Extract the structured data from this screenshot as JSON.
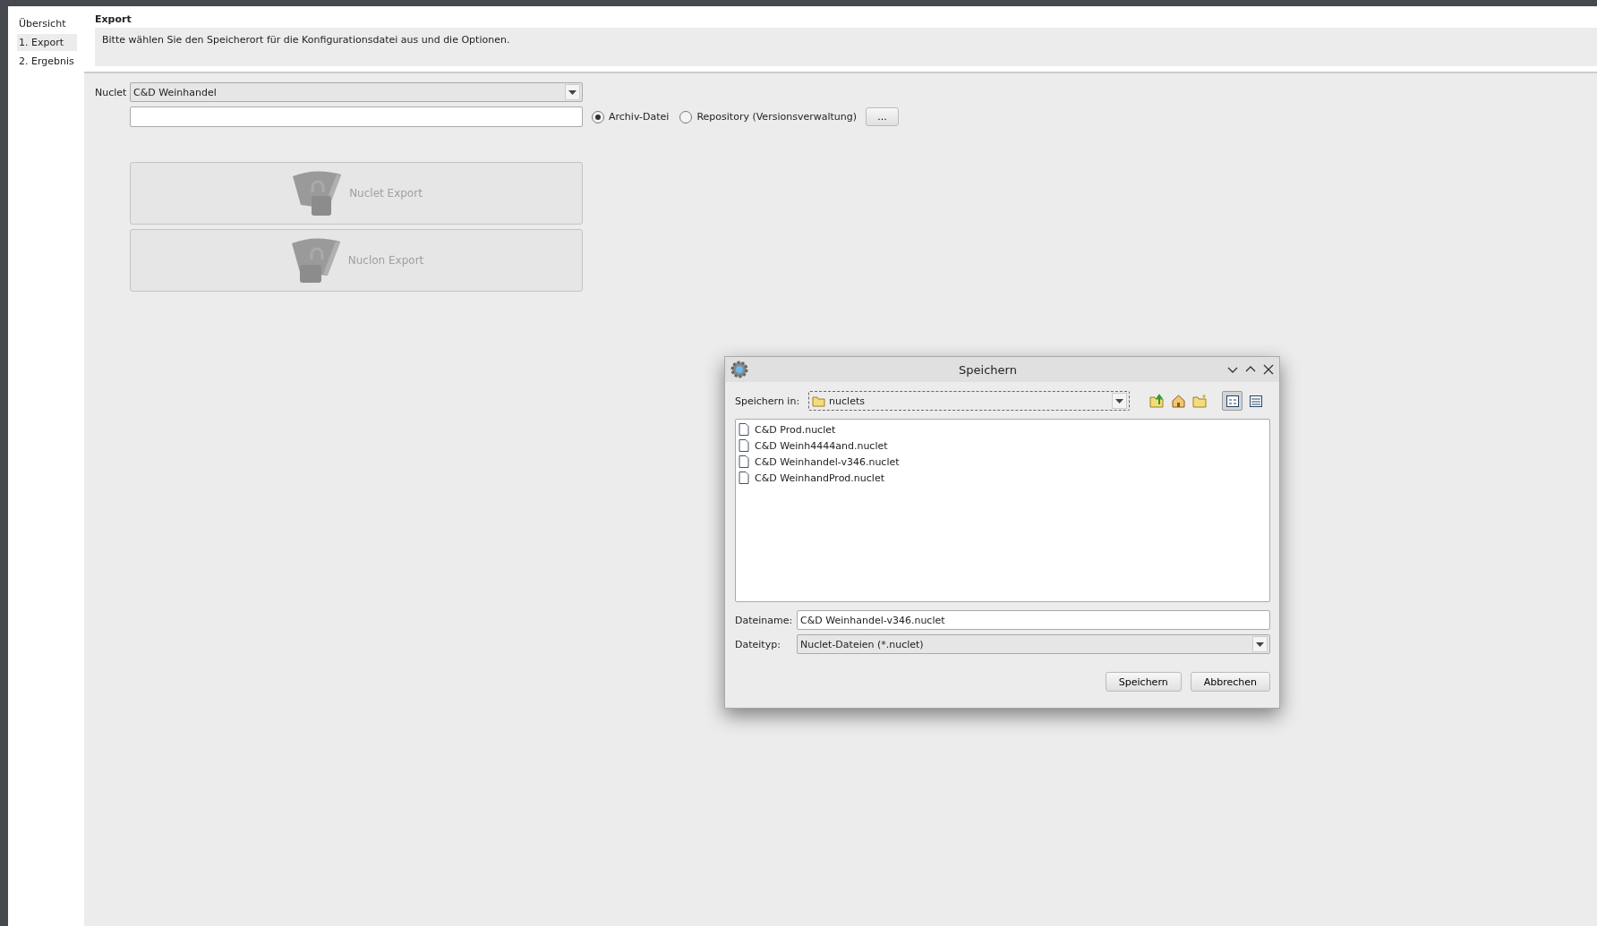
{
  "sidebar": {
    "items": [
      {
        "label": "Übersicht",
        "selected": false
      },
      {
        "label": "1. Export",
        "selected": true
      },
      {
        "label": "2. Ergebnis",
        "selected": false
      }
    ]
  },
  "header": {
    "title": "Export",
    "description": "Bitte wählen Sie den Speicherort für die Konfigurationsdatei aus und die Optionen."
  },
  "form": {
    "nuclet_label": "Nuclet",
    "nuclet_value": "C&D Weinhandel",
    "target_options": [
      {
        "label": "Archiv-Datei",
        "selected": true
      },
      {
        "label": "Repository (Versionsverwaltung)",
        "selected": false
      }
    ],
    "browse_button": "...",
    "export_buttons": [
      {
        "label": "Nuclet Export",
        "disabled": true,
        "kind": "nuclet"
      },
      {
        "label": "Nuclon Export",
        "disabled": true,
        "kind": "nuclon"
      }
    ]
  },
  "dialog": {
    "title": "Speichern",
    "look_in_label": "Speichern in:",
    "look_in_value": "nuclets",
    "view_buttons": [
      {
        "kind": "list",
        "selected": true
      },
      {
        "kind": "details",
        "selected": false
      }
    ],
    "files": [
      "C&D Prod.nuclet",
      "C&D Weinh4444and.nuclet",
      "C&D Weinhandel-v346.nuclet",
      "C&D WeinhandProd.nuclet"
    ],
    "filename_label": "Dateiname:",
    "filename_value": "C&D Weinhandel-v346.nuclet",
    "filetype_label": "Dateityp:",
    "filetype_value": "Nuclet-Dateien (*.nuclet)",
    "buttons": [
      "Speichern",
      "Abbrechen"
    ]
  }
}
